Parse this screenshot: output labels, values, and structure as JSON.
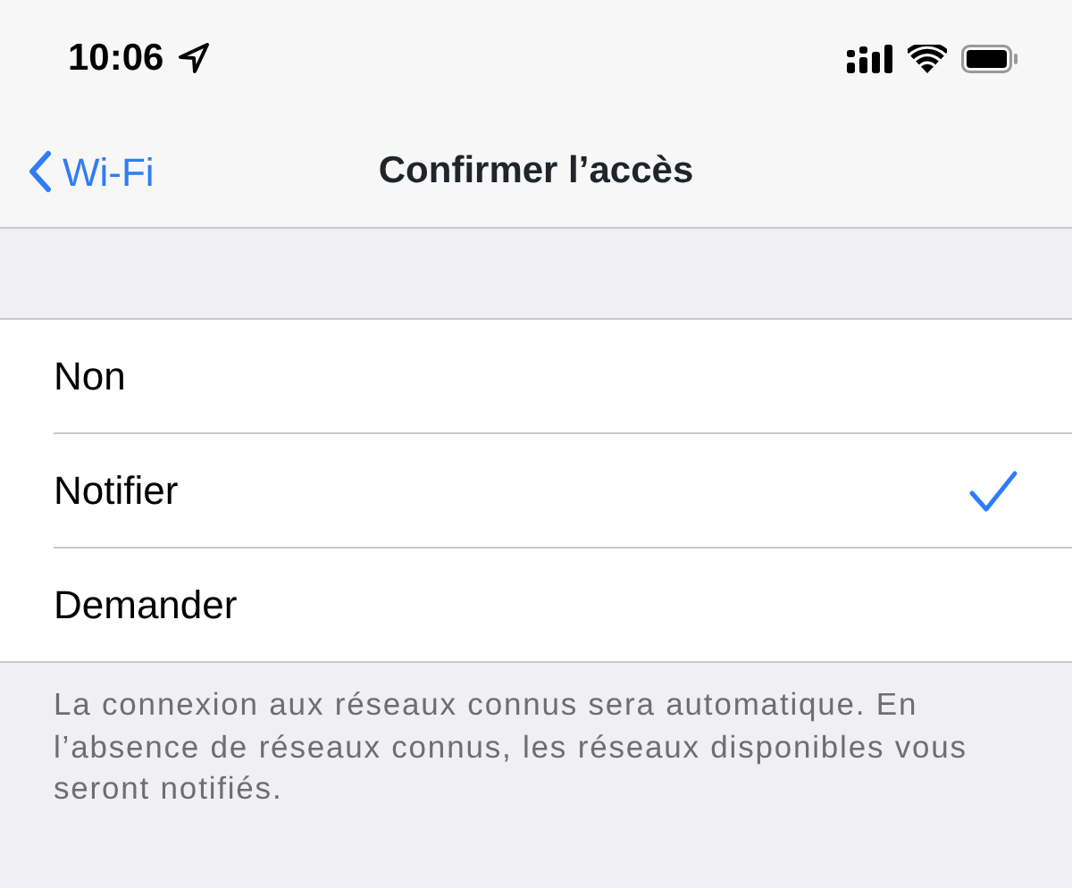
{
  "status_bar": {
    "time": "10:06"
  },
  "nav": {
    "back": "Wi-Fi",
    "title": "Confirmer l’accès"
  },
  "options": [
    {
      "label": "Non",
      "selected": false
    },
    {
      "label": "Notifier",
      "selected": true
    },
    {
      "label": "Demander",
      "selected": false
    }
  ],
  "footer": "La connexion aux réseaux connus sera automatique. En l’absence de réseaux connus, les réseaux disponibles vous seront notifiés."
}
